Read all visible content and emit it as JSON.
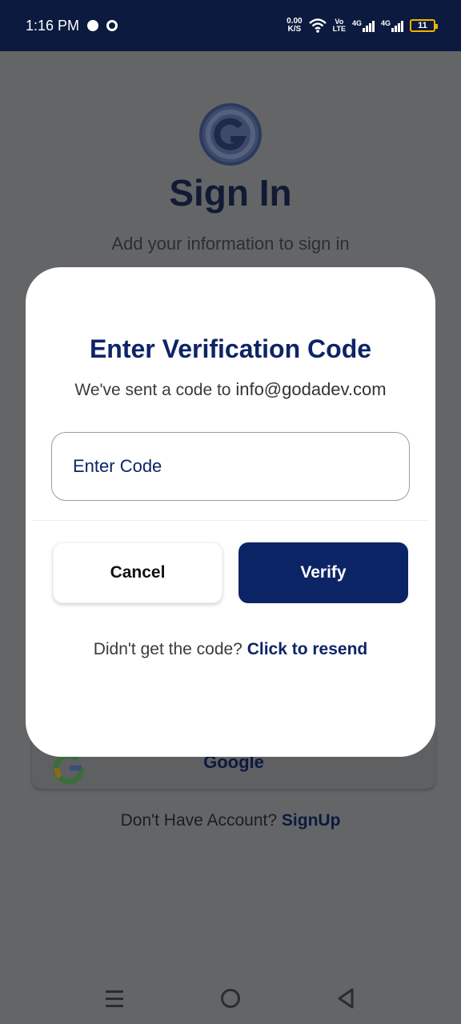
{
  "status_bar": {
    "time": "1:16 PM",
    "net_speed_value": "0.00",
    "net_speed_unit": "K/S",
    "volte_top": "Vo",
    "volte_bottom": "LTE",
    "signal1_label": "4G",
    "signal2_label": "4G",
    "battery_level": "11",
    "icons": [
      "chat-bubble-icon",
      "notification-icon",
      "wifi-icon",
      "signal-icon",
      "battery-icon"
    ]
  },
  "background": {
    "title": "Sign In",
    "subtitle": "Add your information to sign in",
    "google_button_label": "Google",
    "signup_prompt": "Don't Have Account?",
    "signup_link": "SignUp"
  },
  "modal": {
    "title": "Enter Verification Code",
    "description_prefix": "We've sent a code to",
    "email": "info@godadev.com",
    "code_placeholder": "Enter Code",
    "code_value": "",
    "cancel_label": "Cancel",
    "verify_label": "Verify",
    "resend_prompt": "Didn't get the code?",
    "resend_link": "Click to resend"
  },
  "colors": {
    "primary": "#0b2466",
    "status_bar": "#0b1a3e",
    "overlay_bg": "#646567",
    "modal_bg": "#ffffff",
    "battery": "#f3b200"
  }
}
